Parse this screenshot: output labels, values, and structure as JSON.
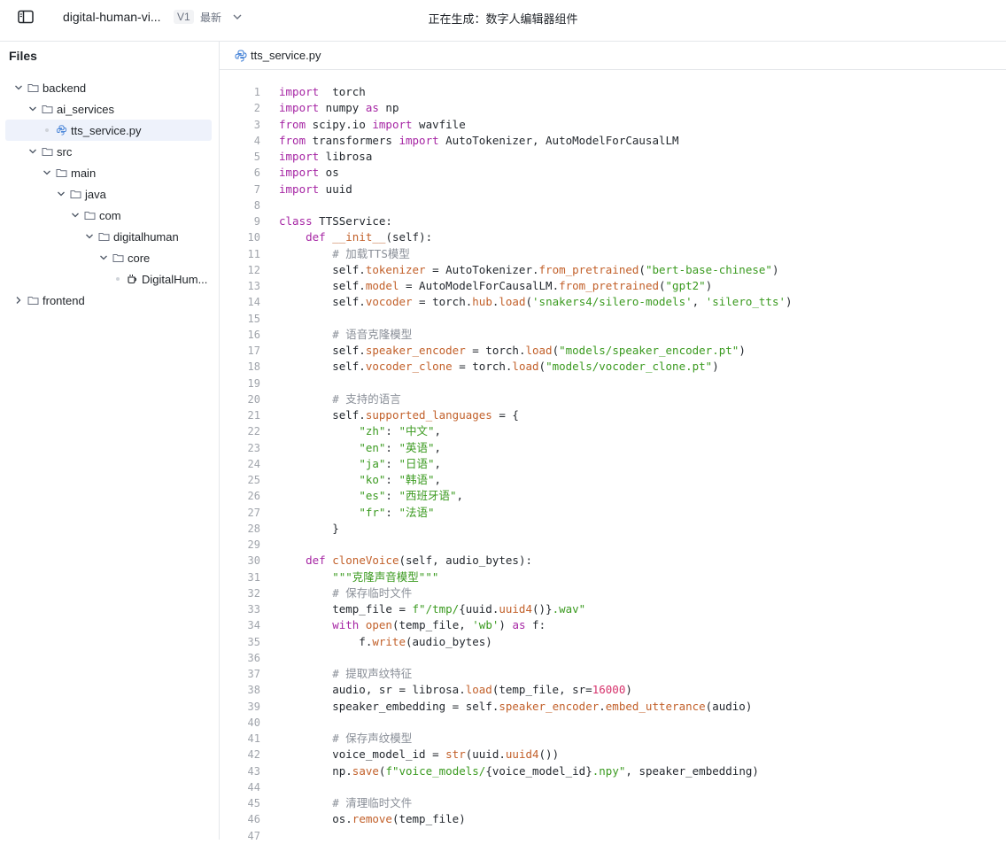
{
  "topbar": {
    "project_name": "digital-human-vi...",
    "version": "V1",
    "latest_label": "最新",
    "status": "正在生成：数字人编辑器组件"
  },
  "sidebar": {
    "title": "Files",
    "tree": [
      {
        "label": "backend",
        "depth": 0,
        "kind": "folder",
        "expanded": true
      },
      {
        "label": "ai_services",
        "depth": 1,
        "kind": "folder",
        "expanded": true
      },
      {
        "label": "tts_service.py",
        "depth": 2,
        "kind": "python",
        "selected": true
      },
      {
        "label": "src",
        "depth": 1,
        "kind": "folder",
        "expanded": true
      },
      {
        "label": "main",
        "depth": 2,
        "kind": "folder",
        "expanded": true
      },
      {
        "label": "java",
        "depth": 3,
        "kind": "folder",
        "expanded": true
      },
      {
        "label": "com",
        "depth": 4,
        "kind": "folder",
        "expanded": true
      },
      {
        "label": "digitalhuman",
        "depth": 5,
        "kind": "folder",
        "expanded": true
      },
      {
        "label": "core",
        "depth": 6,
        "kind": "folder",
        "expanded": true
      },
      {
        "label": "DigitalHum...",
        "depth": 7,
        "kind": "java"
      },
      {
        "label": "frontend",
        "depth": 0,
        "kind": "folder",
        "expanded": false
      }
    ]
  },
  "editor": {
    "tab_label": "tts_service.py",
    "lines": [
      [
        [
          "kw",
          "import"
        ],
        [
          "",
          "  torch"
        ]
      ],
      [
        [
          "kw",
          "import"
        ],
        [
          "",
          " numpy "
        ],
        [
          "kw",
          "as"
        ],
        [
          "",
          " np"
        ]
      ],
      [
        [
          "kw",
          "from"
        ],
        [
          "",
          " scipy.io "
        ],
        [
          "kw",
          "import"
        ],
        [
          "",
          " wavfile"
        ]
      ],
      [
        [
          "kw",
          "from"
        ],
        [
          "",
          " transformers "
        ],
        [
          "kw",
          "import"
        ],
        [
          "",
          " AutoTokenizer, AutoModelForCausalLM"
        ]
      ],
      [
        [
          "kw",
          "import"
        ],
        [
          "",
          " librosa"
        ]
      ],
      [
        [
          "kw",
          "import"
        ],
        [
          "",
          " os"
        ]
      ],
      [
        [
          "kw",
          "import"
        ],
        [
          "",
          " uuid"
        ]
      ],
      [],
      [
        [
          "kw",
          "class"
        ],
        [
          "",
          " TTSService:"
        ]
      ],
      [
        [
          "",
          "    "
        ],
        [
          "kw",
          "def"
        ],
        [
          "",
          "",
          " "
        ],
        [
          "fn",
          "__init__"
        ],
        [
          "",
          "(self):"
        ]
      ],
      [
        [
          "",
          "        "
        ],
        [
          "cm",
          "# 加载TTS模型"
        ]
      ],
      [
        [
          "",
          "        self."
        ],
        [
          "attr",
          "tokenizer"
        ],
        [
          "",
          " = AutoTokenizer."
        ],
        [
          "fn",
          "from_pretrained"
        ],
        [
          "",
          "("
        ],
        [
          "str",
          "\"bert-base-chinese\""
        ],
        [
          "",
          ")"
        ]
      ],
      [
        [
          "",
          "        self."
        ],
        [
          "attr",
          "model"
        ],
        [
          "",
          " = AutoModelForCausalLM."
        ],
        [
          "fn",
          "from_pretrained"
        ],
        [
          "",
          "("
        ],
        [
          "str",
          "\"gpt2\""
        ],
        [
          "",
          ")"
        ]
      ],
      [
        [
          "",
          "        self."
        ],
        [
          "attr",
          "vocoder"
        ],
        [
          "",
          " = torch."
        ],
        [
          "attr",
          "hub"
        ],
        [
          "",
          "."
        ],
        [
          "fn",
          "load"
        ],
        [
          "",
          "("
        ],
        [
          "str",
          "'snakers4/silero-models'"
        ],
        [
          "",
          ", "
        ],
        [
          "str",
          "'silero_tts'"
        ],
        [
          "",
          ")"
        ]
      ],
      [],
      [
        [
          "",
          "        "
        ],
        [
          "cm",
          "# 语音克隆模型"
        ]
      ],
      [
        [
          "",
          "        self."
        ],
        [
          "attr",
          "speaker_encoder"
        ],
        [
          "",
          " = torch."
        ],
        [
          "fn",
          "load"
        ],
        [
          "",
          "("
        ],
        [
          "str",
          "\"models/speaker_encoder.pt\""
        ],
        [
          "",
          ")"
        ]
      ],
      [
        [
          "",
          "        self."
        ],
        [
          "attr",
          "vocoder_clone"
        ],
        [
          "",
          " = torch."
        ],
        [
          "fn",
          "load"
        ],
        [
          "",
          "("
        ],
        [
          "str",
          "\"models/vocoder_clone.pt\""
        ],
        [
          "",
          ")"
        ]
      ],
      [],
      [
        [
          "",
          "        "
        ],
        [
          "cm",
          "# 支持的语言"
        ]
      ],
      [
        [
          "",
          "        self."
        ],
        [
          "attr",
          "supported_languages"
        ],
        [
          "",
          " = {"
        ]
      ],
      [
        [
          "",
          "            "
        ],
        [
          "str",
          "\"zh\""
        ],
        [
          "",
          ": "
        ],
        [
          "str",
          "\"中文\""
        ],
        [
          "",
          ","
        ]
      ],
      [
        [
          "",
          "            "
        ],
        [
          "str",
          "\"en\""
        ],
        [
          "",
          ": "
        ],
        [
          "str",
          "\"英语\""
        ],
        [
          "",
          ","
        ]
      ],
      [
        [
          "",
          "            "
        ],
        [
          "str",
          "\"ja\""
        ],
        [
          "",
          ": "
        ],
        [
          "str",
          "\"日语\""
        ],
        [
          "",
          ","
        ]
      ],
      [
        [
          "",
          "            "
        ],
        [
          "str",
          "\"ko\""
        ],
        [
          "",
          ": "
        ],
        [
          "str",
          "\"韩语\""
        ],
        [
          "",
          ","
        ]
      ],
      [
        [
          "",
          "            "
        ],
        [
          "str",
          "\"es\""
        ],
        [
          "",
          ": "
        ],
        [
          "str",
          "\"西班牙语\""
        ],
        [
          "",
          ","
        ]
      ],
      [
        [
          "",
          "            "
        ],
        [
          "str",
          "\"fr\""
        ],
        [
          "",
          ": "
        ],
        [
          "str",
          "\"法语\""
        ]
      ],
      [
        [
          "",
          "        }"
        ]
      ],
      [],
      [
        [
          "",
          "    "
        ],
        [
          "kw",
          "def"
        ],
        [
          "",
          "",
          " "
        ],
        [
          "fn",
          "cloneVoice"
        ],
        [
          "",
          "(self, audio_bytes):"
        ]
      ],
      [
        [
          "",
          "        "
        ],
        [
          "str",
          "\"\"\"克隆声音模型\"\"\""
        ]
      ],
      [
        [
          "",
          "        "
        ],
        [
          "cm",
          "# 保存临时文件"
        ]
      ],
      [
        [
          "",
          "        temp_file = "
        ],
        [
          "str",
          "f\"/tmp/"
        ],
        [
          "",
          "{uuid."
        ],
        [
          "fn",
          "uuid4"
        ],
        [
          "",
          "()}"
        ],
        [
          "str",
          ".wav\""
        ]
      ],
      [
        [
          "",
          "        "
        ],
        [
          "kw",
          "with"
        ],
        [
          "",
          " "
        ],
        [
          "fn",
          "open"
        ],
        [
          "",
          "(temp_file, "
        ],
        [
          "str",
          "'wb'"
        ],
        [
          "",
          ") "
        ],
        [
          "kw",
          "as"
        ],
        [
          "",
          " f:"
        ]
      ],
      [
        [
          "",
          "            f."
        ],
        [
          "fn",
          "write"
        ],
        [
          "",
          "(audio_bytes)"
        ]
      ],
      [],
      [
        [
          "",
          "        "
        ],
        [
          "cm",
          "# 提取声纹特征"
        ]
      ],
      [
        [
          "",
          "        audio, sr = librosa."
        ],
        [
          "fn",
          "load"
        ],
        [
          "",
          "(temp_file, sr="
        ],
        [
          "num",
          "16000"
        ],
        [
          "",
          ")"
        ]
      ],
      [
        [
          "",
          "        speaker_embedding = self."
        ],
        [
          "attr",
          "speaker_encoder"
        ],
        [
          "",
          "."
        ],
        [
          "fn",
          "embed_utterance"
        ],
        [
          "",
          "(audio)"
        ]
      ],
      [],
      [
        [
          "",
          "        "
        ],
        [
          "cm",
          "# 保存声纹模型"
        ]
      ],
      [
        [
          "",
          "        voice_model_id = "
        ],
        [
          "fn",
          "str"
        ],
        [
          "",
          "(uuid."
        ],
        [
          "fn",
          "uuid4"
        ],
        [
          "",
          "())"
        ]
      ],
      [
        [
          "",
          "        np."
        ],
        [
          "fn",
          "save"
        ],
        [
          "",
          "("
        ],
        [
          "str",
          "f\"voice_models/"
        ],
        [
          "",
          "{voice_model_id}"
        ],
        [
          "str",
          ".npy\""
        ],
        [
          "",
          ", speaker_embedding)"
        ]
      ],
      [],
      [
        [
          "",
          "        "
        ],
        [
          "cm",
          "# 清理临时文件"
        ]
      ],
      [
        [
          "",
          "        os."
        ],
        [
          "fn",
          "remove"
        ],
        [
          "",
          "(temp_file)"
        ]
      ],
      []
    ]
  }
}
